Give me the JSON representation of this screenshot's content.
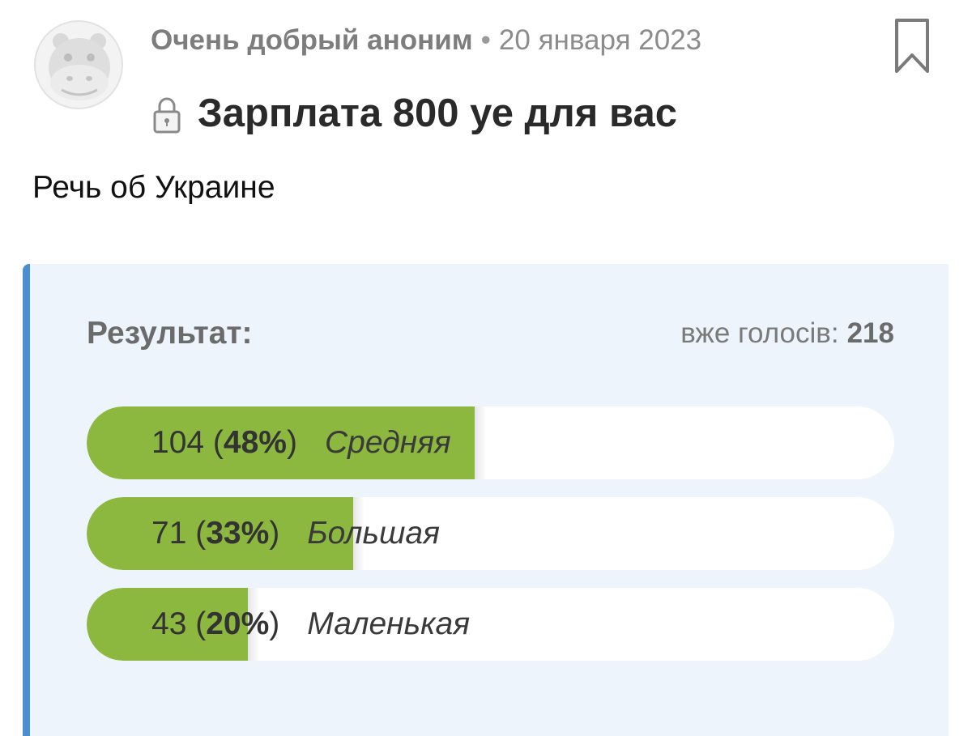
{
  "post": {
    "author": "Очень добрый аноним",
    "separator": "•",
    "date": "20 января 2023",
    "title": "Зарплата 800 уе для вас",
    "body": "Речь об Украине"
  },
  "icons": {
    "avatar": "hippo-avatar-icon",
    "bookmark": "bookmark-icon",
    "lock": "lock-icon"
  },
  "poll": {
    "result_label": "Результат:",
    "votes_label": "вже голосів:",
    "votes_count": "218",
    "options": [
      {
        "count": "104",
        "open": " (",
        "percent": "48%",
        "close": ")",
        "label": "Средняя",
        "fraction": 0.48
      },
      {
        "count": "71",
        "open": " (",
        "percent": "33%",
        "close": ")",
        "label": "Большая",
        "fraction": 0.33
      },
      {
        "count": "43",
        "open": " (",
        "percent": "20%",
        "close": ")",
        "label": "Маленькая",
        "fraction": 0.2
      }
    ]
  },
  "colors": {
    "accent": "#4a8fd1",
    "bar_fill": "#8cb83f",
    "poll_background": "#edf4fb"
  }
}
